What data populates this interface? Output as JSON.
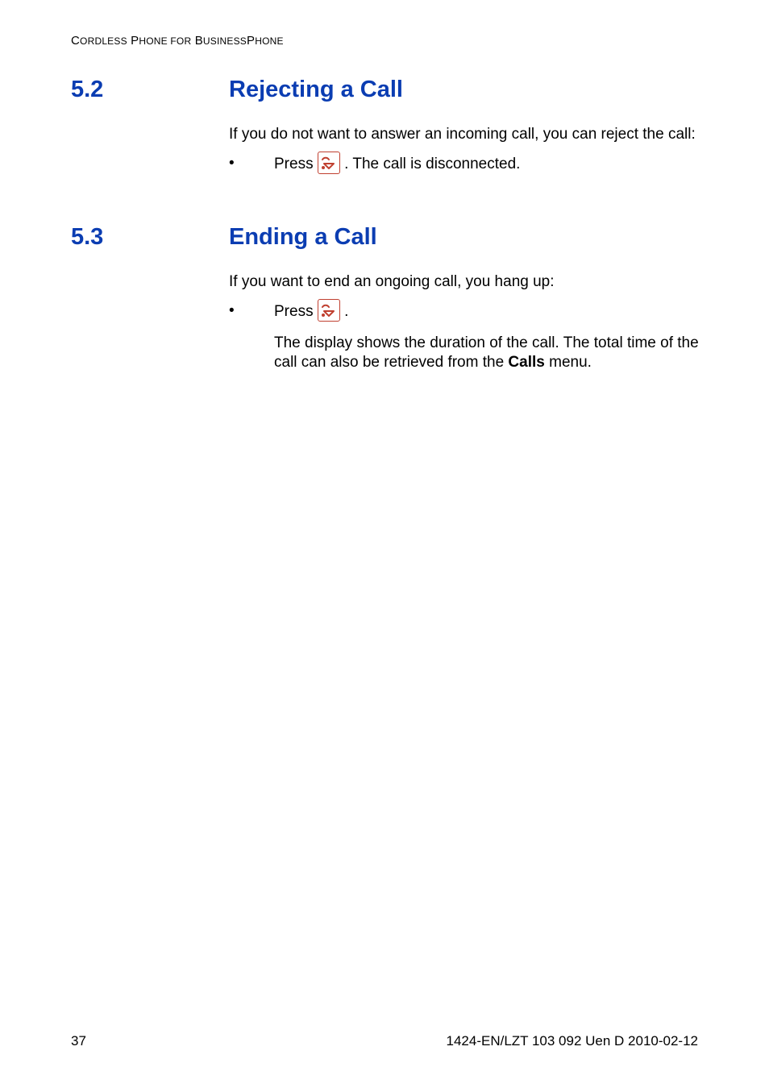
{
  "header": {
    "running": "CORDLESS PHONE FOR BUSINESSPHONE"
  },
  "sections": [
    {
      "number": "5.2",
      "title": "Rejecting a Call",
      "intro": "If you do not want to answer an incoming call, you can reject the call:",
      "bullets": [
        {
          "pre": "Press ",
          "icon": "end-call-icon",
          "post": ". The call is disconnected."
        }
      ]
    },
    {
      "number": "5.3",
      "title": "Ending a Call",
      "intro": "If you want to end an ongoing call, you hang up:",
      "bullets": [
        {
          "pre": "Press ",
          "icon": "end-call-icon",
          "post": ".",
          "after": "The display shows the duration of the call. The total time of the call can also be retrieved from the Calls menu.",
          "after_bold": "Calls"
        }
      ]
    }
  ],
  "footer": {
    "page": "37",
    "docid": "1424-EN/LZT 103 092 Uen D 2010-02-12"
  }
}
